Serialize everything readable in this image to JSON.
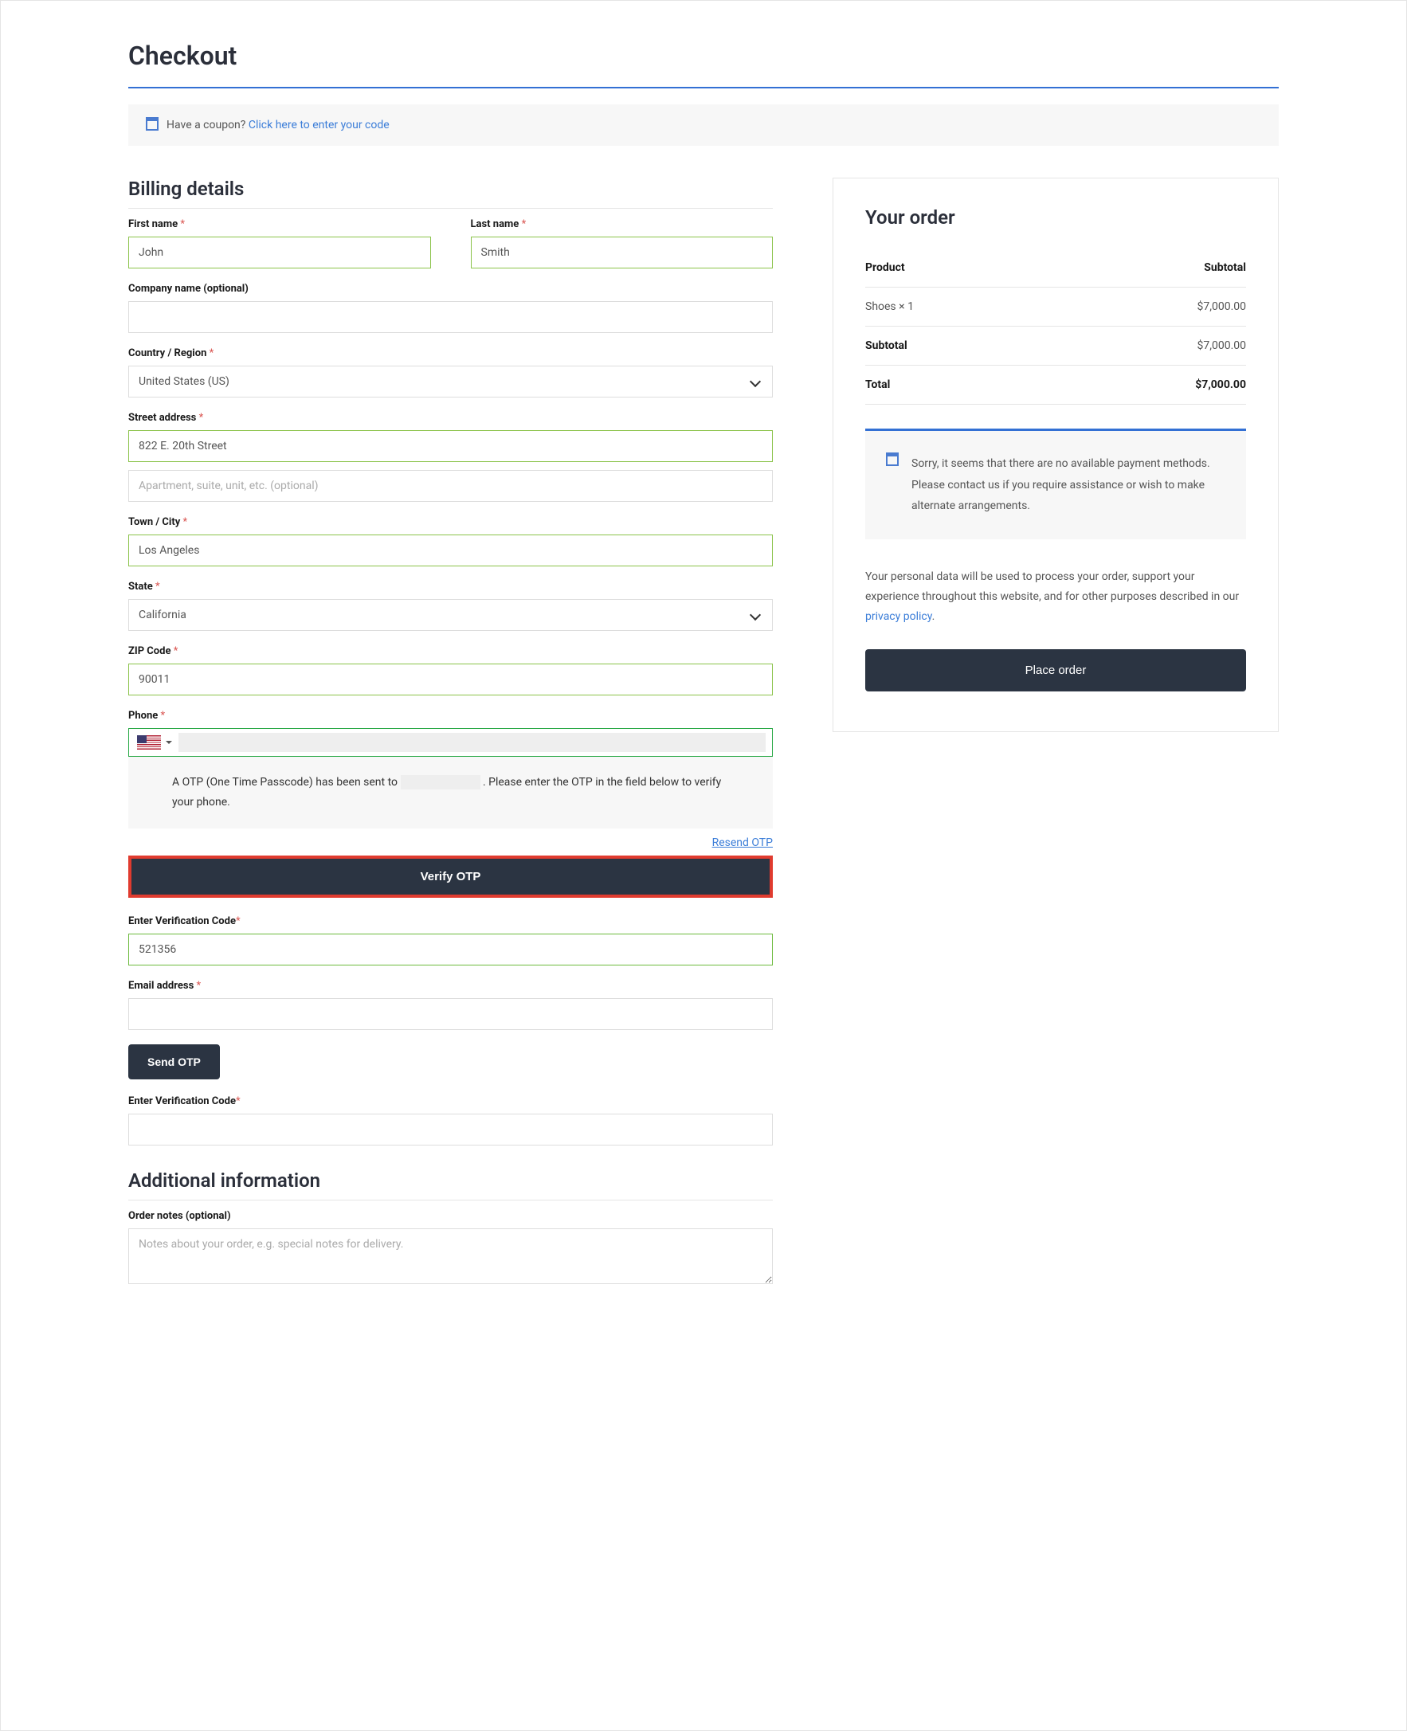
{
  "page_title": "Checkout",
  "coupon": {
    "text": "Have a coupon? ",
    "link": "Click here to enter your code"
  },
  "billing": {
    "heading": "Billing details",
    "first_name_label": "First name ",
    "first_name_value": "John",
    "last_name_label": "Last name ",
    "last_name_value": "Smith",
    "company_label": "Company name (optional)",
    "country_label": "Country / Region ",
    "country_value": "United States (US)",
    "street_label": "Street address ",
    "street_value": "822 E. 20th Street",
    "street2_placeholder": "Apartment, suite, unit, etc. (optional)",
    "city_label": "Town / City ",
    "city_value": "Los Angeles",
    "state_label": "State ",
    "state_value": "California",
    "zip_label": "ZIP Code ",
    "zip_value": "90011",
    "phone_label": "Phone ",
    "otp_msg_pre": "A OTP (One Time Passcode) has been sent to ",
    "otp_msg_post": ". Please enter the OTP in the field below to verify your phone.",
    "resend_label": "Resend OTP",
    "verify_btn": "Verify OTP",
    "vcode_label": "Enter Verification Code",
    "vcode_value": "521356",
    "email_label": "Email address ",
    "send_otp_btn": "Send OTP",
    "vcode2_label": "Enter Verification Code"
  },
  "additional": {
    "heading": "Additional information",
    "notes_label": "Order notes (optional)",
    "notes_placeholder": "Notes about your order, e.g. special notes for delivery."
  },
  "order": {
    "heading": "Your order",
    "th_product": "Product",
    "th_subtotal": "Subtotal",
    "item_name": "Shoes  × 1",
    "item_price": "$7,000.00",
    "subtotal_label": "Subtotal",
    "subtotal_value": "$7,000.00",
    "total_label": "Total",
    "total_value": "$7,000.00",
    "payment_notice": "Sorry, it seems that there are no available payment methods. Please contact us if you require assistance or wish to make alternate arrangements.",
    "privacy_text": "Your personal data will be used to process your order, support your experience throughout this website, and for other purposes described in our ",
    "privacy_link": "privacy policy",
    "privacy_dot": ".",
    "place_order_btn": "Place order"
  }
}
